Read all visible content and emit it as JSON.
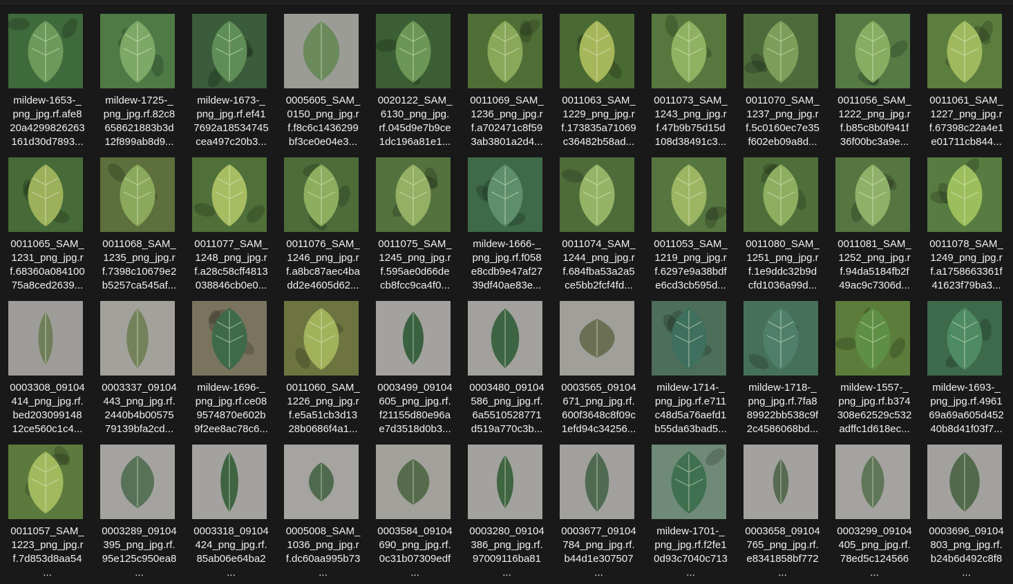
{
  "files": [
    {
      "label": "mildew-1653-_\npng_jpg.rf.afe8\n20a4299826263\n161d30d7893...",
      "bg": "#3f6a3c",
      "leaf": "#6d9a5a",
      "kind": "garden"
    },
    {
      "label": "mildew-1725-_\npng_jpg.rf.82c8\n658621883b3d\n12f899ab8d9...",
      "bg": "#4f7a46",
      "leaf": "#7ea866",
      "kind": "garden"
    },
    {
      "label": "mildew-1673-_\npng_jpg.rf.ef41\n7692a18534745\ncea497c20b3...",
      "bg": "#3a5c3a",
      "leaf": "#5f8d58",
      "kind": "garden"
    },
    {
      "label": "0005605_SAM_\n0150_png_jpg.r\nf.f8c6c1436299\nbf3ce0e04e3...",
      "bg": "#9c9c96",
      "leaf": "#6b8a5c",
      "kind": "ground"
    },
    {
      "label": "0020122_SAM_\n6130_png_jpg.\nrf.045d9e7b9ce\n1dc196a81e1...",
      "bg": "#3b5e34",
      "leaf": "#6c9655",
      "kind": "garden"
    },
    {
      "label": "0011069_SAM_\n1236_png_jpg.r\nf.a702471c8f59\n3ab3801a2d4...",
      "bg": "#4f6e36",
      "leaf": "#8aa85a",
      "kind": "garden"
    },
    {
      "label": "0011063_SAM_\n1229_png_jpg.r\nf.173835a71069\nc36482b58ad...",
      "bg": "#4a6a33",
      "leaf": "#a6b65a",
      "kind": "garden"
    },
    {
      "label": "0011073_SAM_\n1243_png_jpg.r\nf.47b9b75d15d\n108d38491c3...",
      "bg": "#56783f",
      "leaf": "#8fb262",
      "kind": "garden"
    },
    {
      "label": "0011070_SAM_\n1237_png_jpg.r\nf.5c0160ec7e35\nf602eb09a8d...",
      "bg": "#4d6c3c",
      "leaf": "#7c9e5a",
      "kind": "garden"
    },
    {
      "label": "0011056_SAM_\n1222_png_jpg.r\nf.b85c8b0f941f\n36f00bc3a9e...",
      "bg": "#557a44",
      "leaf": "#86ad62",
      "kind": "garden"
    },
    {
      "label": "0011061_SAM_\n1227_png_jpg.r\nf.67398c22a4e1\ne01711cb844...",
      "bg": "#5b7d3e",
      "leaf": "#a0b95f",
      "kind": "garden"
    },
    {
      "label": "0011065_SAM_\n1231_png_jpg.r\nf.68360a084100\n75a8ced2639...",
      "bg": "#466a38",
      "leaf": "#9db05a",
      "kind": "garden"
    },
    {
      "label": "0011068_SAM_\n1235_png_jpg.r\nf.7398c10679e2\nb5257ca545af...",
      "bg": "#5c6f3c",
      "leaf": "#8ba95c",
      "kind": "garden"
    },
    {
      "label": "0011077_SAM_\n1248_png_jpg.r\nf.a28c58cff4813\n038846cb0e0...",
      "bg": "#4f7039",
      "leaf": "#a8bd62",
      "kind": "garden"
    },
    {
      "label": "0011076_SAM_\n1246_png_jpg.r\nf.a8bc87aec4ba\ndd2e4605d62...",
      "bg": "#4c6d3a",
      "leaf": "#8cae5e",
      "kind": "garden"
    },
    {
      "label": "0011075_SAM_\n1245_png_jpg.r\nf.595ae0d66de\ncb8fcc9ca4f0...",
      "bg": "#54723e",
      "leaf": "#93b064",
      "kind": "garden"
    },
    {
      "label": "mildew-1666-_\npng_jpg.rf.f058\ne8cdb9e47af27\n39df40ae83e...",
      "bg": "#3f6a47",
      "leaf": "#5e8e6a",
      "kind": "garden"
    },
    {
      "label": "0011074_SAM_\n1244_png_jpg.r\nf.684fba53a2a5\nce5bb2fcf4fd...",
      "bg": "#4d6c3a",
      "leaf": "#95b467",
      "kind": "garden"
    },
    {
      "label": "0011053_SAM_\n1219_png_jpg.r\nf.6297e9a38bdf\ne6cd3cb595d...",
      "bg": "#567640",
      "leaf": "#9cb562",
      "kind": "garden"
    },
    {
      "label": "0011080_SAM_\n1251_png_jpg.r\nf.1e9ddc32b9d\ncfd1036a99d...",
      "bg": "#4f6f3a",
      "leaf": "#8eae60",
      "kind": "garden"
    },
    {
      "label": "0011081_SAM_\n1252_png_jpg.r\nf.94da5184fb2f\n49ac9c7306d...",
      "bg": "#557541",
      "leaf": "#8fb068",
      "kind": "garden"
    },
    {
      "label": "0011078_SAM_\n1249_png_jpg.r\nf.a1758663361f\n41623f79ba3...",
      "bg": "#577b40",
      "leaf": "#9cbe5c",
      "kind": "garden"
    },
    {
      "label": "0003308_09104\n414_png_jpg.rf.\nbed203099148\n12ce560c1c4...",
      "bg": "#9e9c98",
      "leaf": "#6f7e5a",
      "kind": "plain"
    },
    {
      "label": "0003337_09104\n443_png_jpg.rf.\n2440b4b00575\n79139bfa2cd...",
      "bg": "#a3a19c",
      "leaf": "#74825c",
      "kind": "plain"
    },
    {
      "label": "mildew-1696-_\npng_jpg.rf.ce08\n9574870e602b\n9f2ee8ac78c6...",
      "bg": "#7a745f",
      "leaf": "#3f6a4a",
      "kind": "garden"
    },
    {
      "label": "0011060_SAM_\n1226_png_jpg.r\nf.e5a51cb3d13\n28b0686f4a1...",
      "bg": "#6d7440",
      "leaf": "#a1b25a",
      "kind": "garden"
    },
    {
      "label": "0003499_09104\n605_png_jpg.rf.\nf21155d80e96a\ne7d3518d0b3...",
      "bg": "#a3a29e",
      "leaf": "#3a6140",
      "kind": "plain"
    },
    {
      "label": "0003480_09104\n586_png_jpg.rf.\n6a5510528771\nd519a770c3b...",
      "bg": "#a2a19d",
      "leaf": "#3d6543",
      "kind": "plain"
    },
    {
      "label": "0003565_09104\n671_png_jpg.rf.\n600f3648c8f09c\n1efd94c34256...",
      "bg": "#a09f9a",
      "leaf": "#6b7054",
      "kind": "plain"
    },
    {
      "label": "mildew-1714-_\npng_jpg.rf.e711\nc48d5a76aefd1\nb55da63bad5...",
      "bg": "#4c6e5a",
      "leaf": "#3f6f5e",
      "kind": "garden"
    },
    {
      "label": "mildew-1718-_\npng_jpg.rf.7fa8\n89922bb538c9f\n2c4586068bd...",
      "bg": "#47705a",
      "leaf": "#4f7f6a",
      "kind": "garden"
    },
    {
      "label": "mildew-1557-_\npng_jpg.rf.b374\n308e62529c532\nadffc1d618ec...",
      "bg": "#5b7c3a",
      "leaf": "#5f8f46",
      "kind": "garden"
    },
    {
      "label": "mildew-1693-_\npng_jpg.rf.4961\n69a69a605d452\n40b8d41f03f7...",
      "bg": "#3d6a4a",
      "leaf": "#4e8a62",
      "kind": "garden"
    },
    {
      "label": "0011057_SAM_\n1223_png_jpg.r\nf.7d853d8aa54\n...",
      "bg": "#5c7a3d",
      "leaf": "#a2b95e",
      "kind": "garden"
    },
    {
      "label": "0003289_09104\n395_png_jpg.rf.\n95e125c950ea8\n...",
      "bg": "#a4a39f",
      "leaf": "#587258",
      "kind": "plain"
    },
    {
      "label": "0003318_09104\n424_png_jpg.rf.\n85ab06e64ba2\n...",
      "bg": "#a3a29e",
      "leaf": "#3e6442",
      "kind": "plain"
    },
    {
      "label": "0005008_SAM_\n1036_png_jpg.r\nf.dc60aa995b73\n...",
      "bg": "#a5a4a0",
      "leaf": "#4f6a4e",
      "kind": "plain"
    },
    {
      "label": "0003584_09104\n690_png_jpg.rf.\n0c31b07309edf\n...",
      "bg": "#a2a19c",
      "leaf": "#566b4c",
      "kind": "plain"
    },
    {
      "label": "0003280_09104\n386_png_jpg.rf.\n97009116ba81\n...",
      "bg": "#a3a29e",
      "leaf": "#3f6541",
      "kind": "plain"
    },
    {
      "label": "0003677_09104\n784_png_jpg.rf.\nb44d1e307507\n...",
      "bg": "#a1a09c",
      "leaf": "#4f6a50",
      "kind": "plain"
    },
    {
      "label": "mildew-1701-_\npng_jpg.rf.f2fe1\n0d93c7040c713\n...",
      "bg": "#6f8a78",
      "leaf": "#3f7050",
      "kind": "garden"
    },
    {
      "label": "0003658_09104\n765_png_jpg.rf.\ne8341858bf772\n...",
      "bg": "#a3a29e",
      "leaf": "#576b53",
      "kind": "plain"
    },
    {
      "label": "0003299_09104\n405_png_jpg.rf.\n78ed5c124566\n...",
      "bg": "#a4a3a0",
      "leaf": "#607658",
      "kind": "plain"
    },
    {
      "label": "0003696_09104\n803_png_jpg.rf.\nb24b6d492c8f8\n...",
      "bg": "#a2a19d",
      "leaf": "#52694c",
      "kind": "plain"
    }
  ]
}
